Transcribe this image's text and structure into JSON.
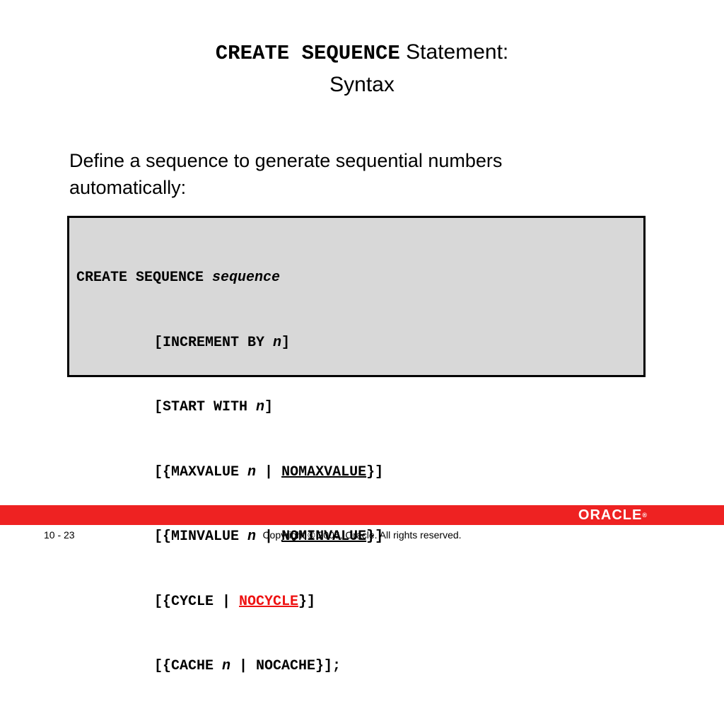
{
  "title": {
    "keyword": "CREATE SEQUENCE",
    "rest": "Statement:",
    "line2": "Syntax"
  },
  "intro": {
    "line1": "Define a sequence to generate sequential numbers",
    "line2": "automatically:"
  },
  "code": {
    "l1_kw": "CREATE SEQUENCE ",
    "l1_var": "sequence",
    "l2_a": "[INCREMENT BY ",
    "l2_var": "n",
    "l2_b": "]",
    "l3_a": "[START WITH ",
    "l3_var": "n",
    "l3_b": "]",
    "l4_a": "[{MAXVALUE ",
    "l4_var": "n",
    "l4_sep": " | ",
    "l4_def": "NOMAXVALUE",
    "l4_b": "}]",
    "l5_a": "[{MINVALUE ",
    "l5_var": "n",
    "l5_sep": " | ",
    "l5_def": "NOMINVALUE",
    "l5_b": "}]",
    "l6_a": "[{CYCLE | ",
    "l6_def": "NOCYCLE",
    "l6_b": "}]",
    "l7_a": "[{CACHE ",
    "l7_var": "n",
    "l7_b": " | NOCACHE}];"
  },
  "footer": {
    "logo": "ORACLE",
    "page": "10 - 23",
    "copyright": "Copyright © 2006, Oracle. All rights reserved."
  },
  "colors": {
    "footer_bar": "#ee2222",
    "highlight_default": "#ee1111",
    "code_background": "#d8d8d8"
  }
}
